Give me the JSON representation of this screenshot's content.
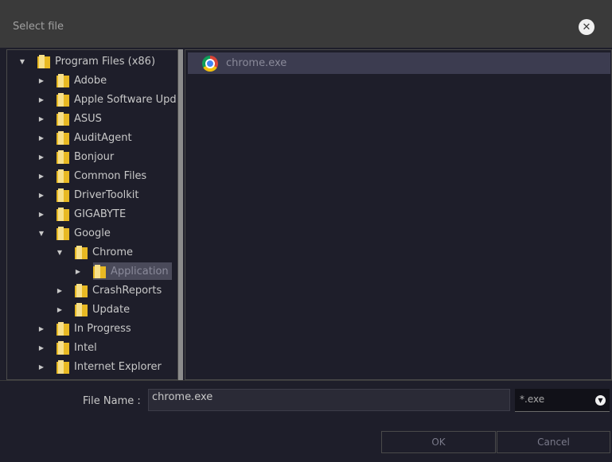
{
  "dialog": {
    "title": "Select file"
  },
  "tree": [
    {
      "label": "Program Files (x86)",
      "level": 0,
      "expanded": true
    },
    {
      "label": "Adobe",
      "level": 1,
      "expanded": false
    },
    {
      "label": "Apple Software Upd",
      "level": 1,
      "expanded": false
    },
    {
      "label": "ASUS",
      "level": 1,
      "expanded": false
    },
    {
      "label": "AuditAgent",
      "level": 1,
      "expanded": false
    },
    {
      "label": "Bonjour",
      "level": 1,
      "expanded": false
    },
    {
      "label": "Common Files",
      "level": 1,
      "expanded": false
    },
    {
      "label": "DriverToolkit",
      "level": 1,
      "expanded": false
    },
    {
      "label": "GIGABYTE",
      "level": 1,
      "expanded": false
    },
    {
      "label": "Google",
      "level": 1,
      "expanded": true
    },
    {
      "label": "Chrome",
      "level": 2,
      "expanded": true
    },
    {
      "label": "Application",
      "level": 3,
      "expanded": false,
      "selected": true
    },
    {
      "label": "CrashReports",
      "level": 2,
      "expanded": false
    },
    {
      "label": "Update",
      "level": 2,
      "expanded": false
    },
    {
      "label": "In Progress",
      "level": 1,
      "expanded": false
    },
    {
      "label": "Intel",
      "level": 1,
      "expanded": false
    },
    {
      "label": "Internet Explorer",
      "level": 1,
      "expanded": false
    }
  ],
  "files": [
    {
      "name": "chrome.exe",
      "icon": "chrome-icon"
    }
  ],
  "footer": {
    "file_name_label": "File Name :",
    "file_name_value": "chrome.exe",
    "filter_value": "*.exe",
    "ok_label": "OK",
    "cancel_label": "Cancel"
  },
  "colors": {
    "background": "#1e1e2a",
    "titlebar": "#3a3a3a",
    "selection": "#3c3c50",
    "folder": "#e8b923"
  }
}
